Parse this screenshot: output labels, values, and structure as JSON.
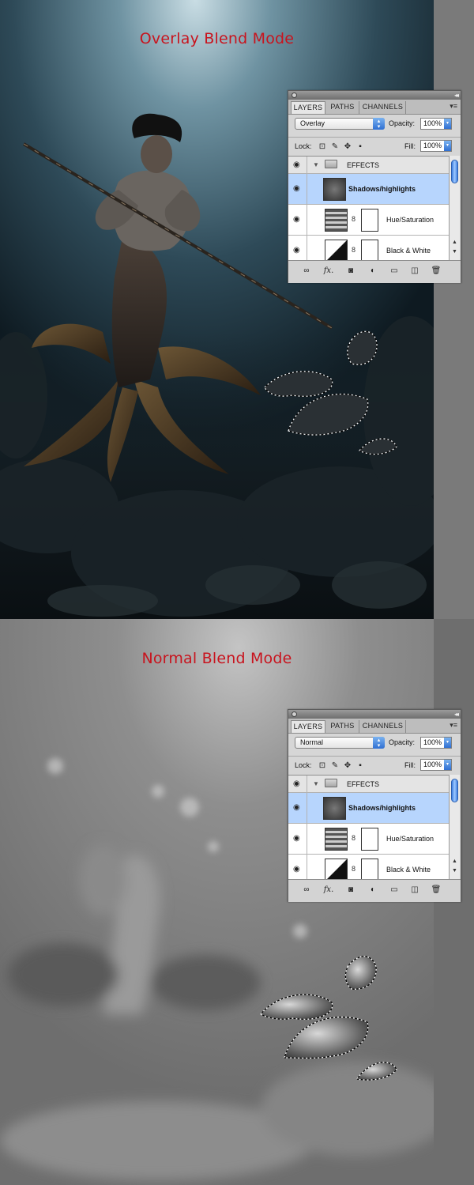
{
  "sections": [
    {
      "heading": "Overlay Blend Mode",
      "panel": {
        "tabs": [
          "LAYERS",
          "PATHS",
          "CHANNELS"
        ],
        "blend_mode": "Overlay",
        "opacity_label": "Opacity:",
        "opacity_value": "100%",
        "lock_label": "Lock:",
        "fill_label": "Fill:",
        "fill_value": "100%",
        "layers": [
          {
            "name": "EFFECTS",
            "type": "group"
          },
          {
            "name": "Shadows/highlights",
            "type": "layer",
            "selected": true
          },
          {
            "name": "Hue/Saturation",
            "type": "adjustment"
          },
          {
            "name": "Black & White",
            "type": "adjustment"
          }
        ]
      }
    },
    {
      "heading": "Normal Blend Mode",
      "panel": {
        "tabs": [
          "LAYERS",
          "PATHS",
          "CHANNELS"
        ],
        "blend_mode": "Normal",
        "opacity_label": "Opacity:",
        "opacity_value": "100%",
        "lock_label": "Lock:",
        "fill_label": "Fill:",
        "fill_value": "100%",
        "layers": [
          {
            "name": "EFFECTS",
            "type": "group"
          },
          {
            "name": "Shadows/highlights",
            "type": "layer",
            "selected": true
          },
          {
            "name": "Hue/Saturation",
            "type": "adjustment"
          },
          {
            "name": "Black & White",
            "type": "adjustment"
          }
        ]
      }
    }
  ],
  "icons": {
    "lock": [
      "transparency-lock-icon",
      "brush-lock-icon",
      "move-lock-icon",
      "padlock-icon"
    ],
    "footer": [
      "link-layers-icon",
      "fx-icon",
      "add-mask-icon",
      "adjustment-layer-icon",
      "new-group-icon",
      "new-layer-icon",
      "trash-icon"
    ]
  },
  "colors": {
    "heading": "#c8141e",
    "selected_row": "#b7d5fd",
    "panel_bg": "#d6d6d6"
  }
}
